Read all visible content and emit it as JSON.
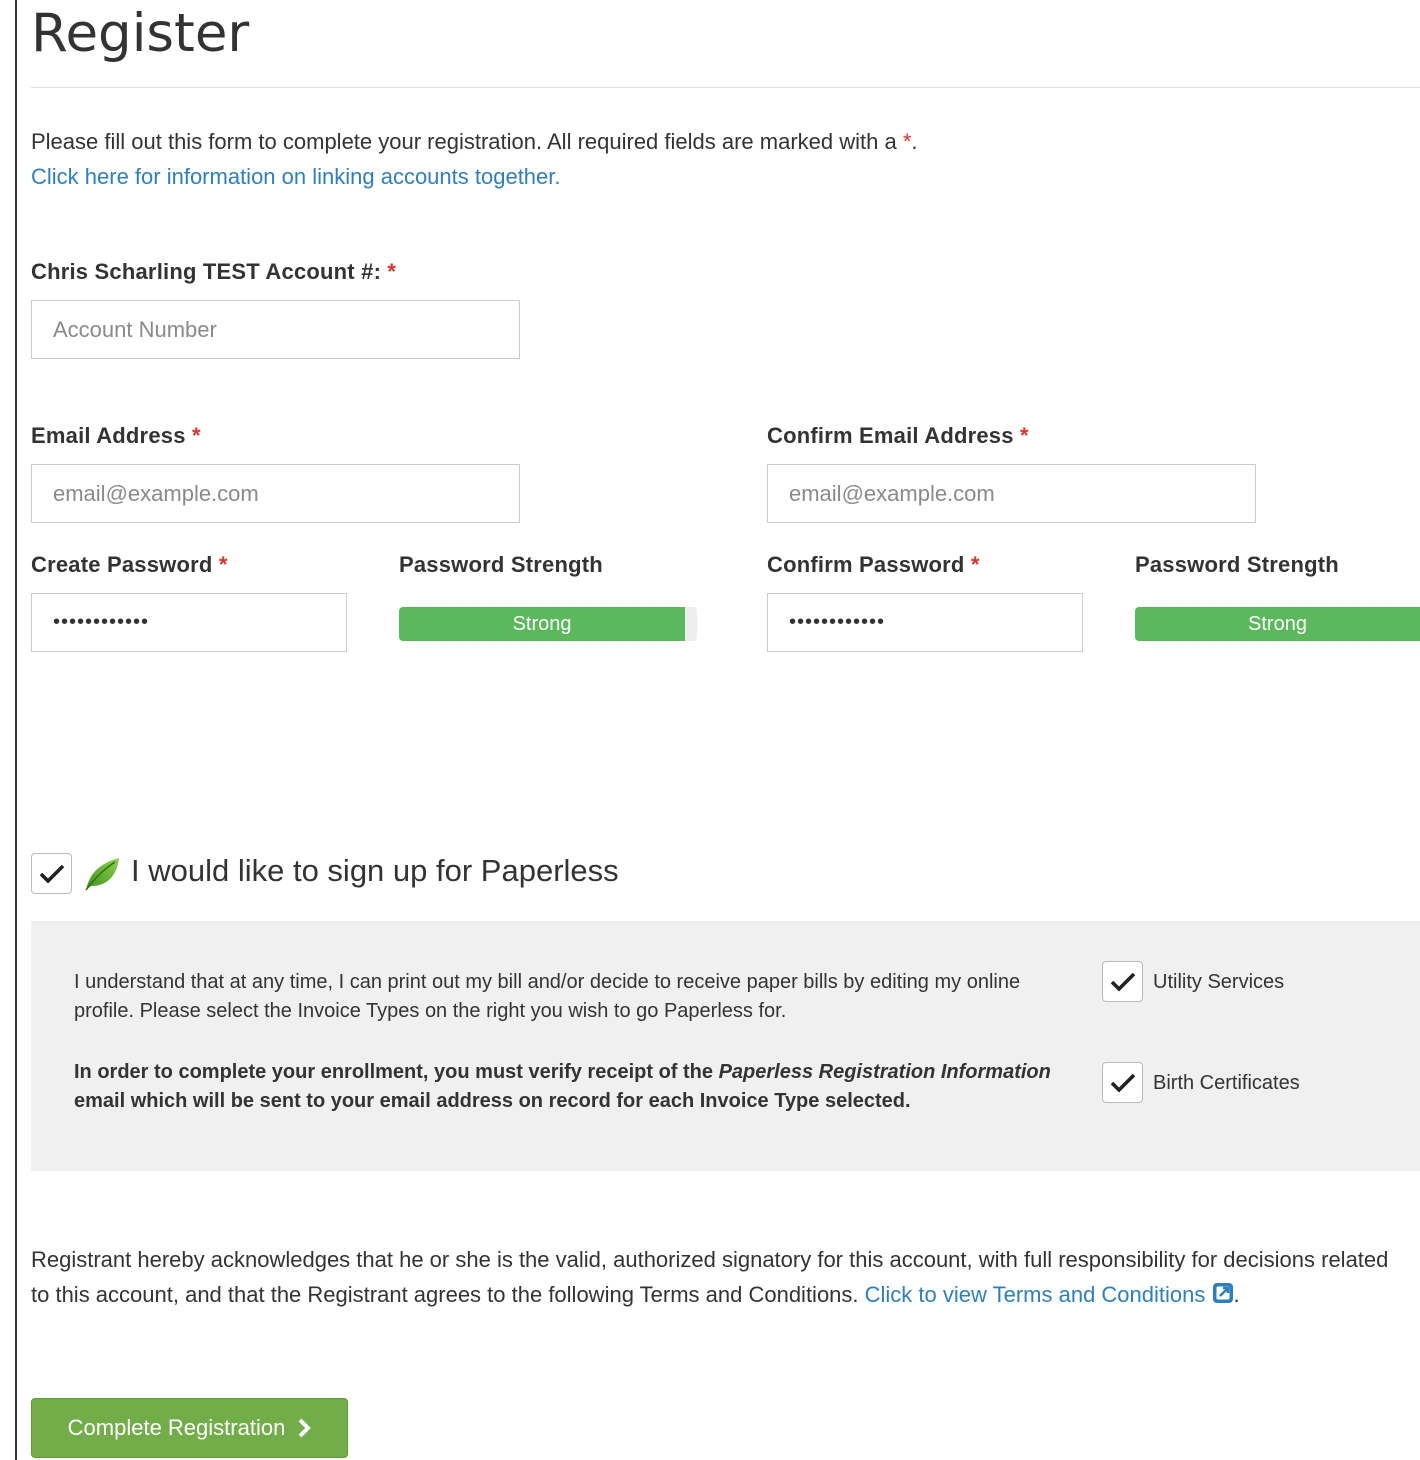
{
  "page": {
    "title": "Register"
  },
  "intro": {
    "text": "Please fill out this form to complete your registration. All required fields are marked with a ",
    "asterisk": "*",
    "period": ".",
    "link": "Click here for information on linking accounts together."
  },
  "account": {
    "label": "Chris Scharling TEST Account #:",
    "required": "*",
    "placeholder": "Account Number"
  },
  "email": {
    "label": "Email Address",
    "required": "*",
    "placeholder": "email@example.com"
  },
  "confirm_email": {
    "label": "Confirm Email Address",
    "required": "*",
    "placeholder": "email@example.com"
  },
  "password": {
    "label": "Create Password",
    "required": "*",
    "value": "••••••••••••",
    "strength_label": "Password Strength",
    "strength_text": "Strong",
    "strength_level": 0.96
  },
  "confirm_password": {
    "label": "Confirm Password",
    "required": "*",
    "value": "••••••••••••",
    "strength_label": "Password Strength",
    "strength_text": "Strong",
    "strength_level": 1.0
  },
  "paperless": {
    "checked": true,
    "label": "I would like to sign up for Paperless",
    "icon": "leaf-icon",
    "info_text": "I understand that at any time, I can print out my bill and/or decide to receive paper bills by editing my online profile. Please select the Invoice Types on the right you wish to go Paperless for.",
    "verify_text_1": "In order to complete your enrollment, you must verify receipt of the ",
    "verify_text_italic": "Paperless Registration Information",
    "verify_text_2": " email which will be sent to your email address on record for each Invoice Type selected.",
    "invoice_types": [
      {
        "label": "Utility Services",
        "checked": true
      },
      {
        "label": "Birth Certificates",
        "checked": true
      }
    ]
  },
  "terms": {
    "text": "Registrant hereby acknowledges that he or she is the valid, authorized signatory for this account, with full responsibility for decisions related to this account, and that the Registrant agrees to the following Terms and Conditions. ",
    "link": "Click to view Terms and Conditions",
    "period": "."
  },
  "submit": {
    "label": "Complete Registration"
  },
  "colors": {
    "accent_green": "#5cb85c",
    "button_green": "#72ad4a",
    "link_blue": "#2f7fbd",
    "required_red": "#d9342b"
  }
}
